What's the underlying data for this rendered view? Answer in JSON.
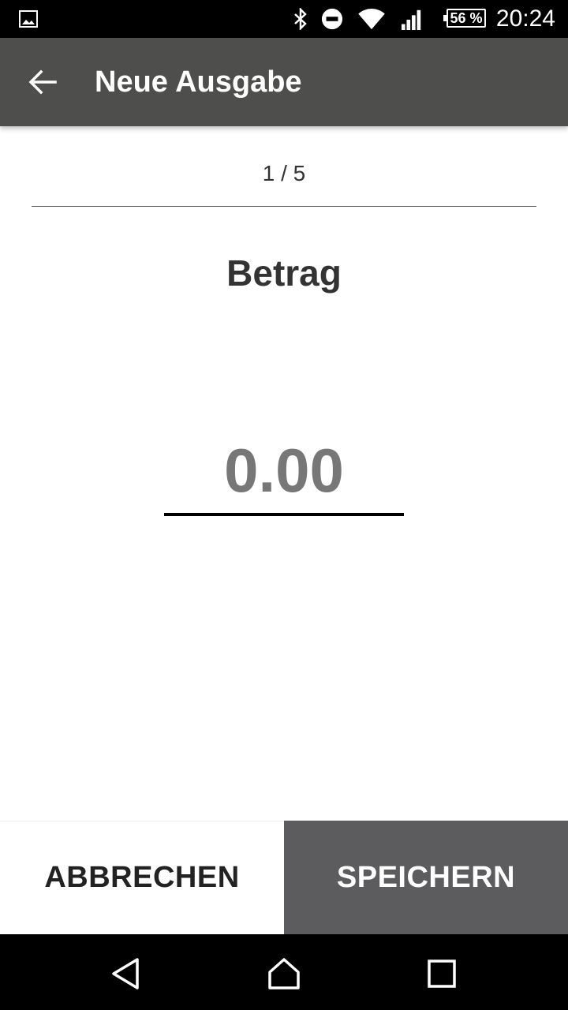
{
  "status_bar": {
    "time": "20:24",
    "battery": "56 %",
    "icons": [
      "image-icon",
      "bluetooth-icon",
      "do-not-disturb-icon",
      "wifi-icon",
      "signal-icon",
      "battery-icon"
    ]
  },
  "toolbar": {
    "title": "Neue Ausgabe",
    "back_icon": "arrow-back-icon"
  },
  "form": {
    "step": "1 / 5",
    "heading": "Betrag",
    "amount_placeholder": "0.00"
  },
  "buttons": {
    "cancel_label": "ABBRECHEN",
    "save_label": "SPEICHERN"
  },
  "colors": {
    "toolbar": "#4e4e4c",
    "save_button": "#5c5c5e",
    "placeholder": "#777777"
  },
  "nav_bar": {
    "icons": [
      "back-triangle-icon",
      "home-icon",
      "recents-icon"
    ]
  }
}
